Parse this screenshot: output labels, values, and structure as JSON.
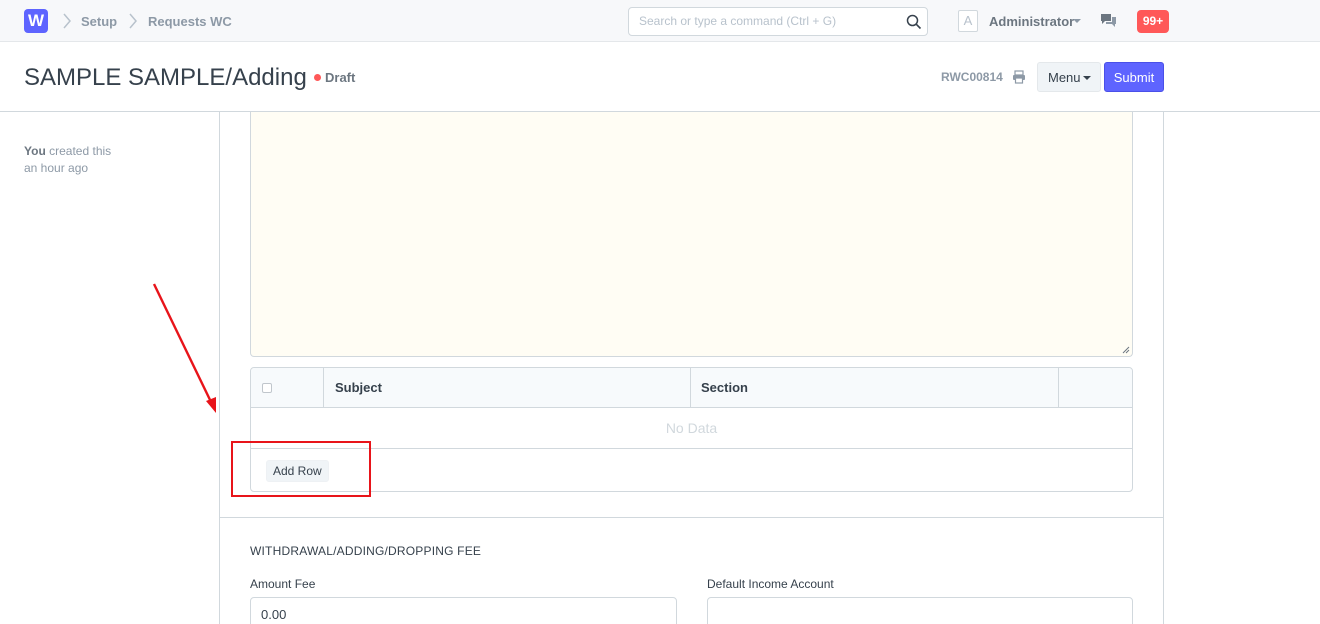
{
  "navbar": {
    "logo_letter": "W",
    "breadcrumbs": [
      "Setup",
      "Requests WC"
    ],
    "search_placeholder": "Search or type a command (Ctrl + G)",
    "avatar_letter": "A",
    "user_name": "Administrator",
    "notifications": "99+"
  },
  "page": {
    "title": "SAMPLE SAMPLE/Adding",
    "status": "Draft",
    "doc_name": "RWC00814",
    "menu_label": "Menu",
    "submit_label": "Submit"
  },
  "timeline": {
    "actor": "You",
    "action": "created this",
    "when": "an hour ago"
  },
  "grid": {
    "columns": [
      "Subject",
      "Section"
    ],
    "empty_text": "No Data",
    "add_row_label": "Add Row"
  },
  "fee_section": {
    "title": "WITHDRAWAL/ADDING/DROPPING FEE",
    "amount_label": "Amount Fee",
    "amount_value": "0.00",
    "account_label": "Default Income Account",
    "account_value": ""
  },
  "colors": {
    "primary": "#5e64ff",
    "draft_dot": "#ff5858",
    "annotation": "#e8141a",
    "textarea_bg": "#fffdf4"
  }
}
